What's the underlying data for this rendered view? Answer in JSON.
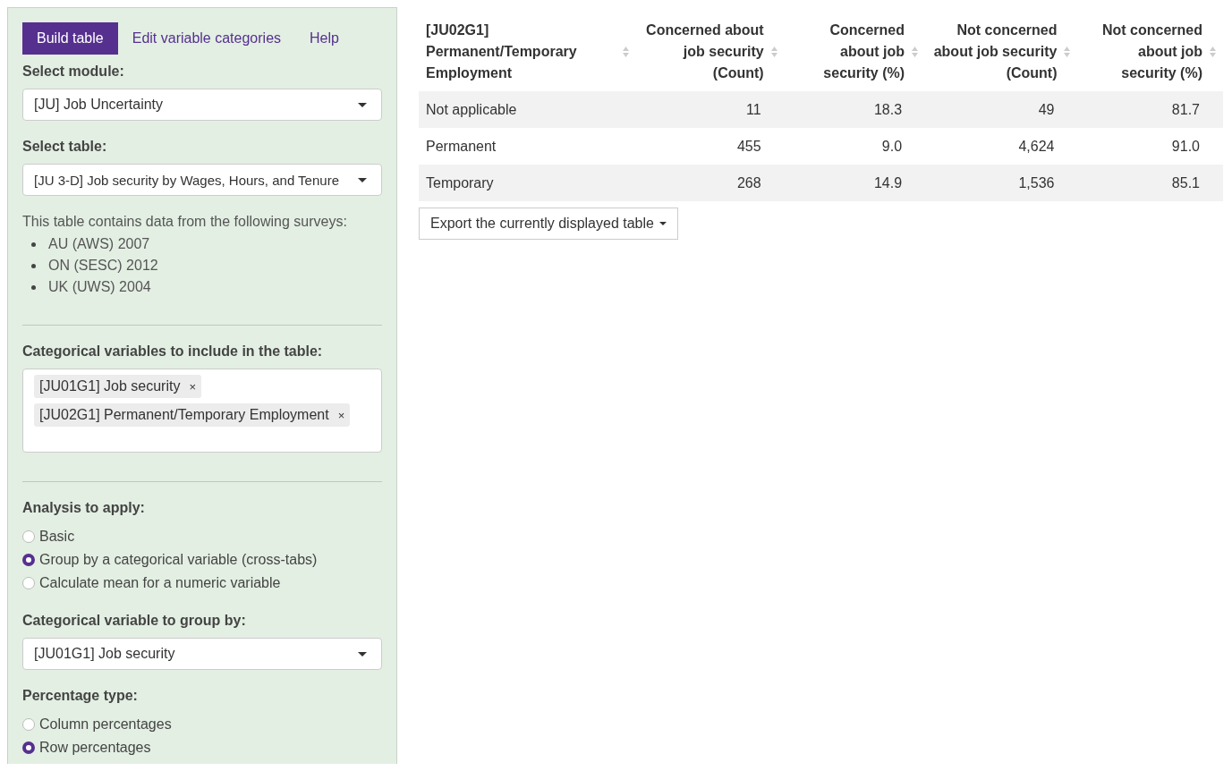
{
  "tabs": [
    {
      "label": "Build table",
      "selected": true
    },
    {
      "label": "Edit variable categories",
      "selected": false
    },
    {
      "label": "Help",
      "selected": false
    }
  ],
  "module": {
    "label": "Select module:",
    "value": "[JU] Job Uncertainty"
  },
  "table_select": {
    "label": "Select table:",
    "value": "[JU 3-D] Job security by Wages, Hours, and Tenure"
  },
  "surveys": {
    "intro": "This table contains data from the following surveys:",
    "items": [
      "AU (AWS) 2007",
      "ON (SESC) 2012",
      "UK (UWS) 2004"
    ]
  },
  "variables": {
    "label": "Categorical variables to include in the table:",
    "tags": [
      "[JU01G1] Job security",
      "[JU02G1] Permanent/Temporary Employment"
    ],
    "remove": "×"
  },
  "analysis": {
    "label": "Analysis to apply:",
    "options": [
      {
        "label": "Basic",
        "selected": false
      },
      {
        "label": "Group by a categorical variable (cross-tabs)",
        "selected": true
      },
      {
        "label": "Calculate mean for a numeric variable",
        "selected": false
      }
    ]
  },
  "group_by": {
    "label": "Categorical variable to group by:",
    "value": "[JU01G1] Job security"
  },
  "percentage": {
    "label": "Percentage type:",
    "options": [
      {
        "label": "Column percentages",
        "selected": false
      },
      {
        "label": "Row percentages",
        "selected": true
      }
    ]
  },
  "table": {
    "columns": [
      "[JU02G1] Permanent/Temporary Employment",
      "Concerned about job security (Count)",
      "Concerned about job security (%)",
      "Not concerned about job security (Count)",
      "Not concerned about job security (%)"
    ],
    "rows": [
      [
        "Not applicable",
        "11",
        "18.3",
        "49",
        "81.7"
      ],
      [
        "Permanent",
        "455",
        "9.0",
        "4,624",
        "91.0"
      ],
      [
        "Temporary",
        "268",
        "14.9",
        "1,536",
        "85.1"
      ]
    ]
  },
  "export_button": "Export the currently displayed table"
}
